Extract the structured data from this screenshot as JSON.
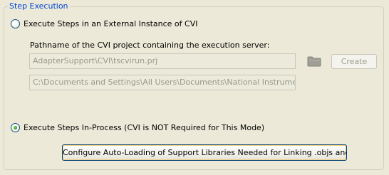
{
  "group": {
    "title": "Step Execution"
  },
  "external_option": {
    "label": "Execute Steps in an External Instance of CVI",
    "checked": false
  },
  "pathname": {
    "label": "Pathname of the CVI project containing the execution server:",
    "project_path": "AdapterSupport\\CVI\\tscvirun.prj",
    "full_path": "C:\\Documents and Settings\\All Users\\Documents\\National Instruments\\Test"
  },
  "toolbar": {
    "browse_icon": "folder-icon",
    "create_label": "Create"
  },
  "inprocess_option": {
    "label": "Execute Steps In-Process (CVI is NOT Required for This Mode)",
    "checked": true
  },
  "configure_button": {
    "label": "Configure Auto-Loading of Support Libraries Needed for Linking .objs and .libs..."
  },
  "colors": {
    "group_title": "#0046d5",
    "background": "#ece9d8",
    "disabled_text": "#9a998c"
  }
}
